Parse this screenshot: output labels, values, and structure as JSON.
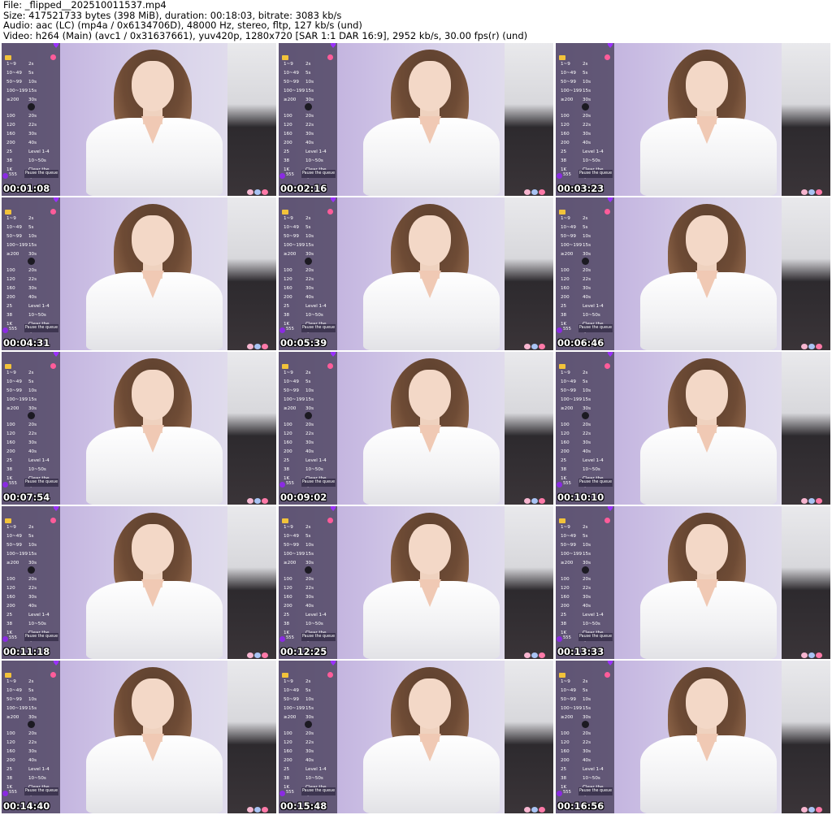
{
  "header": {
    "line1": "File: _flipped__202510011537.mp4",
    "line2": "Size: 417521733 bytes (398 MiB), duration: 00:18:03, bitrate: 3083 kb/s",
    "line3": "Audio: aac (LC) (mp4a / 0x6134706D), 48000 Hz, stereo, fltp, 127 kb/s (und)",
    "line4": "Video: h264 (Main) (avc1 / 0x31637661), yuv420p, 1280x720 [SAR 1:1 DAR 16:9], 2952 kb/s, 30.00 fps(r) (und)"
  },
  "panel": {
    "rows": [
      {
        "a": "1~9",
        "b": "2s"
      },
      {
        "a": "10~49",
        "b": "5s"
      },
      {
        "a": "50~99",
        "b": "10s"
      },
      {
        "a": "100~199",
        "b": "15s"
      },
      {
        "a": "≥200",
        "b": "30s"
      },
      {
        "a": "100",
        "b": "20s"
      },
      {
        "a": "120",
        "b": "22s"
      },
      {
        "a": "160",
        "b": "30s"
      },
      {
        "a": "200",
        "b": "40s"
      },
      {
        "a": "25",
        "b": "Level 1-4"
      },
      {
        "a": "38",
        "b": "10~50s"
      },
      {
        "a": "1K",
        "b": "Clear the Queue"
      }
    ],
    "pause_label": "Pause the queue",
    "bottom_label": "555"
  },
  "thumbnails": [
    {
      "timestamp": "00:01:08"
    },
    {
      "timestamp": "00:02:16"
    },
    {
      "timestamp": "00:03:23"
    },
    {
      "timestamp": "00:04:31"
    },
    {
      "timestamp": "00:05:39"
    },
    {
      "timestamp": "00:06:46"
    },
    {
      "timestamp": "00:07:54"
    },
    {
      "timestamp": "00:09:02"
    },
    {
      "timestamp": "00:10:10"
    },
    {
      "timestamp": "00:11:18"
    },
    {
      "timestamp": "00:12:25"
    },
    {
      "timestamp": "00:13:33"
    },
    {
      "timestamp": "00:14:40"
    },
    {
      "timestamp": "00:15:48"
    },
    {
      "timestamp": "00:16:56"
    }
  ],
  "colors": {
    "panel_bg": "#463e58",
    "heart_icon": "#9b30ff",
    "crown_icon": "#f2c33a",
    "smile_icon": "#ff5c9a"
  }
}
